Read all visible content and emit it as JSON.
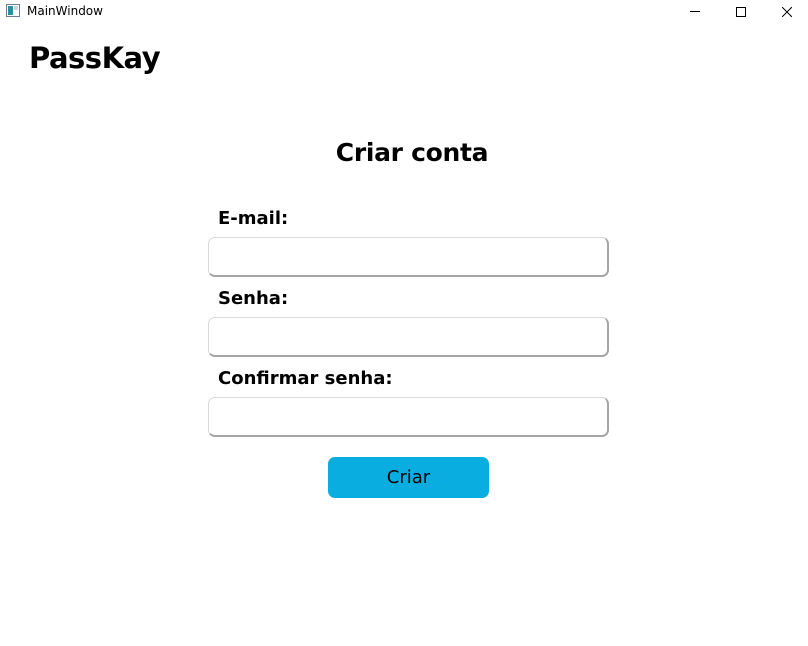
{
  "window": {
    "title": "MainWindow",
    "controls": {
      "minimize_icon": "minimize-icon",
      "maximize_icon": "maximize-icon",
      "close_icon": "close-icon"
    }
  },
  "app": {
    "title": "PassKay"
  },
  "form": {
    "title": "Criar conta",
    "fields": [
      {
        "label": "E-mail:",
        "value": "",
        "placeholder": ""
      },
      {
        "label": "Senha:",
        "value": "",
        "placeholder": ""
      },
      {
        "label": "Confirmar senha:",
        "value": "",
        "placeholder": ""
      }
    ],
    "submit_label": "Criar"
  },
  "colors": {
    "accent": "#0aade0",
    "background": "#ffffff",
    "text": "#000000",
    "input_border": "#a5a5a5"
  }
}
